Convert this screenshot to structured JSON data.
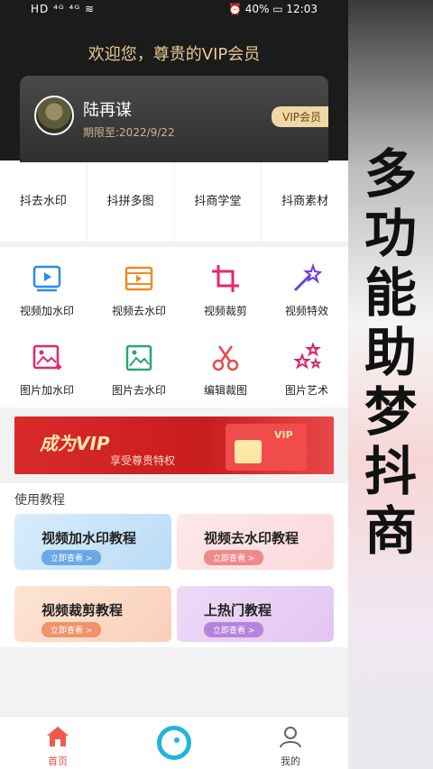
{
  "status_bar": {
    "left": "HD ⁴ᴳ ⁴ᴳ ≋",
    "right": "⏰ 40% ▭ 12:03"
  },
  "header": {
    "welcome": "欢迎您，尊贵的VIP会员",
    "user_name": "陆再谋",
    "expire": "期限至:2022/9/22",
    "vip_badge": "VIP会员"
  },
  "quick_tabs": [
    "抖去水印",
    "抖拼多图",
    "抖商学堂",
    "抖商素材"
  ],
  "tools": [
    {
      "label": "视频加水印",
      "icon": "video-watermark-add-icon"
    },
    {
      "label": "视频去水印",
      "icon": "video-watermark-remove-icon"
    },
    {
      "label": "视频裁剪",
      "icon": "video-crop-icon"
    },
    {
      "label": "视频特效",
      "icon": "magic-wand-icon"
    },
    {
      "label": "图片加水印",
      "icon": "image-watermark-add-icon"
    },
    {
      "label": "图片去水印",
      "icon": "image-watermark-remove-icon"
    },
    {
      "label": "编辑裁图",
      "icon": "scissors-icon"
    },
    {
      "label": "图片艺术",
      "icon": "stars-icon"
    }
  ],
  "banner": {
    "title": "成为VIP",
    "subtitle": "享受尊贵特权",
    "tag": "VIP"
  },
  "tutorials": {
    "title": "使用教程",
    "items": [
      {
        "name": "视频加水印教程",
        "button": "立即查看 >"
      },
      {
        "name": "视频去水印教程",
        "button": "立即查看 >"
      },
      {
        "name": "视频裁剪教程",
        "button": "立即查看 >"
      },
      {
        "name": "上热门教程",
        "button": "立即查看 >"
      }
    ]
  },
  "bottom_nav": {
    "home": "首页",
    "mine": "我的"
  },
  "promo_side": "多功能助梦抖商",
  "colors": {
    "accent": "#e64d4d",
    "gold": "#e9c993",
    "blue": "#1fb6d9"
  }
}
